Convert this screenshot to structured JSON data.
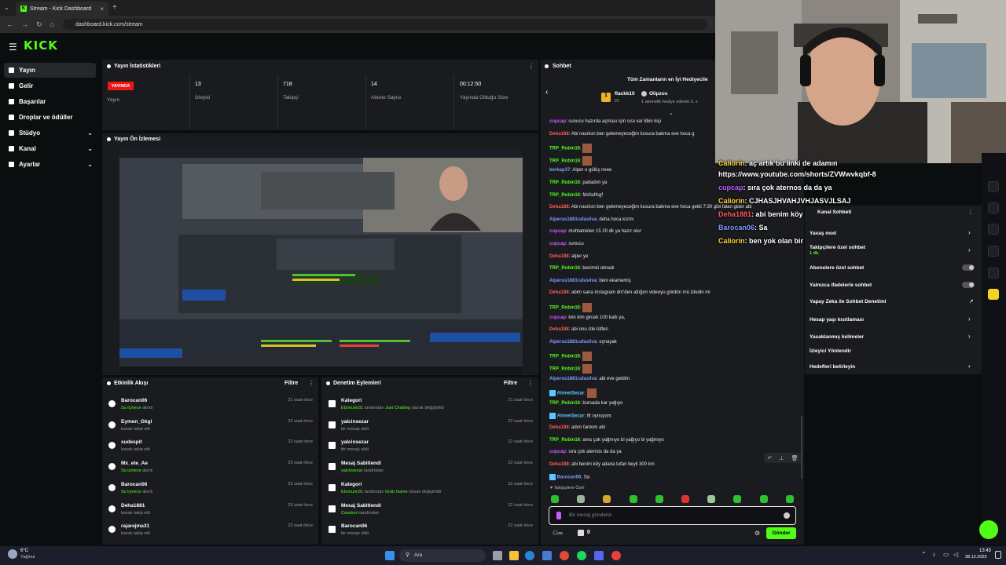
{
  "browser": {
    "tab_title": "Stream - Kick Dashboard",
    "url": "dashboard.kick.com/stream"
  },
  "brand": {
    "logo_text": "KICK",
    "accent": "#53fc18"
  },
  "sidebar": {
    "items": [
      {
        "label": "Yayın",
        "active": true
      },
      {
        "label": "Gelir"
      },
      {
        "label": "Başarılar"
      },
      {
        "label": "Droplar ve ödüller"
      },
      {
        "label": "Stüdyo",
        "expandable": true
      },
      {
        "label": "Kanal",
        "expandable": true
      },
      {
        "label": "Ayarlar",
        "expandable": true
      }
    ]
  },
  "stats": {
    "title": "Yayın İstatistikleri",
    "live_badge": "YAYINDA",
    "live_label": "Yayın",
    "items": [
      {
        "value": "13",
        "label": "İzleyici"
      },
      {
        "value": "718",
        "label": "Takipçi"
      },
      {
        "value": "14",
        "label": "Abone Sayısı"
      },
      {
        "value": "00:12:50",
        "label": "Yayında Olduğu Süre"
      }
    ]
  },
  "preview": {
    "title": "Yayın Ön İzlemesi"
  },
  "activity": {
    "title": "Etkinlik Akışı",
    "filter": "Filtre",
    "rows": [
      {
        "name": "Barocan06",
        "highlight": "Su içmece",
        "action": "akıntı",
        "time": "21 saat önce"
      },
      {
        "name": "Eymen_Gkgi",
        "action": "kanalı takip etti",
        "time": "22 saat önce"
      },
      {
        "name": "sudespit",
        "action": "kanalı takip etti",
        "time": "22 saat önce"
      },
      {
        "name": "Mx_ete_Ae",
        "highlight": "Su içmece",
        "action": "akıntı",
        "time": "23 saat önce"
      },
      {
        "name": "Barocan06",
        "highlight": "Su içmece",
        "action": "akıntı",
        "time": "23 saat önce"
      },
      {
        "name": "Deha1881",
        "action": "kanalı takip etti",
        "time": "23 saat önce"
      },
      {
        "name": "rajarejma31",
        "action": "kanalı takip etti",
        "time": "23 saat önce"
      }
    ]
  },
  "moderation": {
    "title": "Denetim Eylemleri",
    "filter": "Filtre",
    "rows": [
      {
        "name": "Kategori",
        "user": "Ebonunn31",
        "mid": " tarafından ",
        "highlight": "Just Chatting",
        "action": " olarak değiştirildi",
        "time": "21 saat önce"
      },
      {
        "name": "yalcinsezar",
        "action": "bir mesajı sildi",
        "time": "22 saat önce"
      },
      {
        "name": "yalcinsezar",
        "action": "bir mesajı sildi",
        "time": "22 saat önce"
      },
      {
        "name": "Mesaj Sabitlendi",
        "user": "yalcinsezar",
        "mid": " tarafından",
        "time": "22 saat önce"
      },
      {
        "name": "Kategori",
        "user": "Ebonunn31",
        "mid": " tarafından ",
        "highlight": "Grab Game",
        "action": " olarak değiştirildi",
        "time": "22 saat önce"
      },
      {
        "name": "Mesaj Sabitlendi",
        "user": "Casirium",
        "mid": " tarafından",
        "time": "22 saat önce"
      },
      {
        "name": "Barocan06",
        "action": "bir mesajı sildi",
        "time": "22 saat önce"
      }
    ]
  },
  "chat": {
    "title": "Sohbet",
    "gifters_title": "Tüm Zamanların en İyi Hediyecile",
    "gifter1": {
      "name": "flackk10",
      "count": "21"
    },
    "gifter2": {
      "name": "Olipzos",
      "note": "1 abonelik hediye ederek 3. s"
    },
    "messages": [
      {
        "user": "cupcap",
        "color": "#c65cff",
        "text": ": sunucu hazırda açması için sıra var 8bin kişi"
      },
      {
        "user": "Deha188",
        "color": "#ff5b5b",
        "text": ": Abi nasılsın ben gelemeyeceğim kusura bakma eve hoca g"
      },
      {
        "user": "TRP_Robin16",
        "color": "#53fc18",
        "text": ":",
        "emote": true
      },
      {
        "user": "TRP_Robin16",
        "color": "#53fc18",
        "text": ":",
        "emote": true
      },
      {
        "user": "berkap37",
        "color": "#7c9cff",
        "text": ": Alper o gülüş neee"
      },
      {
        "user": "TRP_Robin16",
        "color": "#53fc18",
        "text": ": patladım ya"
      },
      {
        "user": "TRP_Robin16",
        "color": "#53fc18",
        "text": ": fdsfsdfsgf"
      },
      {
        "user": "Deha188",
        "color": "#ff5b5b",
        "text": ": Abi nasılsın ben gelemeyeceğim kusura bakma eve hoca geldi 7:30 gibi falan gider abi"
      },
      {
        "user": "Alperus1881rafasilva",
        "color": "#7c9cff",
        "text": ": deha hoca kızmı"
      },
      {
        "user": "cupcap",
        "color": "#c65cff",
        "text": ": muhtamelen 15 20 dk ya hazır olur"
      },
      {
        "user": "cupcap",
        "color": "#c65cff",
        "text": ": sunucu"
      },
      {
        "user": "Deha188",
        "color": "#ff5b5b",
        "text": ": alper ye"
      },
      {
        "user": "TRP_Robin16",
        "color": "#53fc18",
        "text": ": benimki olmadı"
      },
      {
        "user": "Alperus1881rafasilva",
        "color": "#7c9cff",
        "text": ": beni ekamemiş"
      },
      {
        "user": "Deha188",
        "color": "#ff5b5b",
        "text": ": abim sana Instagram dm'den attığım videoyu gördün mü izledin mi"
      },
      {
        "user": "TRP_Robin16",
        "color": "#53fc18",
        "text": ":",
        "emote": true
      },
      {
        "user": "cupcap",
        "color": "#c65cff",
        "text": ": kim kim gircek 100 katlı ya,"
      },
      {
        "user": "Deha188",
        "color": "#ff5b5b",
        "text": ": abi onu izle lütfen"
      },
      {
        "user": "Alperus1881rafasilva",
        "color": "#7c9cff",
        "text": ": oynayak"
      },
      {
        "user": "TRP_Robin16",
        "color": "#53fc18",
        "text": ":",
        "emote": true
      },
      {
        "user": "TRP_Robin16",
        "color": "#53fc18",
        "text": ":",
        "emote": true
      },
      {
        "user": "Alperus1881rafasilva",
        "color": "#7c9cff",
        "text": ": abi eve geldim"
      },
      {
        "user": "AhmetSezar",
        "color": "#5bc8ff",
        "text": ":",
        "emote": true
      },
      {
        "user": "TRP_Robin16",
        "color": "#53fc18",
        "text": ": bursada kar yağıyo"
      },
      {
        "user": "AhmetSezar",
        "color": "#5bc8ff",
        "text": ": tft oynuyom"
      },
      {
        "user": "Deha188",
        "color": "#ff5b5b",
        "text": ": adım fantom abi"
      },
      {
        "user": "TRP_Robin16",
        "color": "#53fc18",
        "text": ": ama çok yağmıyo bi yağıyo bi yağmıyo"
      },
      {
        "user": "cupcap",
        "color": "#c65cff",
        "text": ": sıra çok aternos da da ya"
      },
      {
        "user": "Deha188",
        "color": "#ff5b5b",
        "text": ": abi benim köy adana tufan beyli 300 km"
      },
      {
        "user": "Barocan06",
        "color": "#7c9cff",
        "text": ": Sa"
      }
    ],
    "followers_only_label": "Takipçilere Özel",
    "input_placeholder": "Bir mesaj gönderin",
    "send_label": "Gönder",
    "points": "0"
  },
  "overlay_chat": [
    {
      "user": "Caliorin",
      "color": "#ffd23b",
      "text": ": aç artık bu linki de adamın"
    },
    {
      "user": "",
      "color": "#fff",
      "text": "https://www.youtube.com/shorts/ZVWwvkqbf-8"
    },
    {
      "user": "cupcap",
      "color": "#c65cff",
      "text": ": sıra çok aternos da da ya"
    },
    {
      "user": "Caliorin",
      "color": "#ffd23b",
      "text": ": CJHASJHVAHJVHJASVJLSAJ"
    },
    {
      "user": "Deha1881",
      "color": "#ff5b5b",
      "text": ": abi benim köy adana tufan beyli 300 km"
    },
    {
      "user": "Barocan06",
      "color": "#7c9cff",
      "text": ": Sa"
    },
    {
      "user": "Caliorin",
      "color": "#ffd23b",
      "text": ": ben yok olan bir adamım"
    }
  ],
  "chat_settings": {
    "header": "Kanal Sohbeti",
    "slow_mode": "Yavaş mod",
    "followers_only": "Takipçilere özel sohbet",
    "followers_only_value": "1 dk.",
    "subscribers_only": "Abonelere özel sohbet",
    "emotes_only": "Yalnızca ifadelerle sohbet",
    "ai_moderation": "Yapay Zeka ile Sohbet Denetimi",
    "age_restriction": "Hesap yaşı kısıtlaması",
    "banned_words": "Yasaklanmış kelimeler",
    "viewer_redirect": "İzleyici Yönlendir",
    "set_goals": "Hedefleri belirleyin"
  },
  "taskbar": {
    "weather_temp": "6°C",
    "weather_text": "Yağmur",
    "search_placeholder": "Ara",
    "time": "13:45",
    "date": "28.12.2025"
  }
}
